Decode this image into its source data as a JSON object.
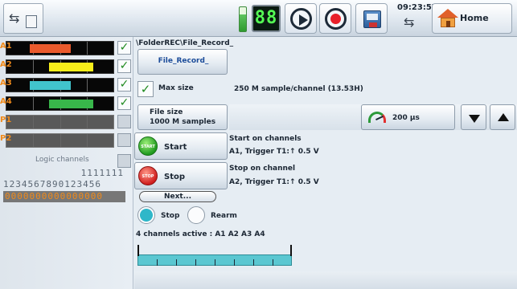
{
  "toolbar": {
    "counter": "88",
    "clock_time": "09:23:57",
    "home_label": "Home",
    "icons": [
      "usb-storage-icon",
      "battery-icon",
      "play-icon",
      "record-icon",
      "disk-icon",
      "usb-icon",
      "home-icon"
    ]
  },
  "channels": [
    {
      "label": "A1",
      "checked": true,
      "fill_color": "#ea5a2c",
      "fill_start": 0.22,
      "fill_end": 0.6
    },
    {
      "label": "A2",
      "checked": true,
      "fill_color": "#f7ee1a",
      "fill_start": 0.4,
      "fill_end": 0.81
    },
    {
      "label": "A3",
      "checked": true,
      "fill_color": "#41c4cc",
      "fill_start": 0.22,
      "fill_end": 0.6
    },
    {
      "label": "A4",
      "checked": true,
      "fill_color": "#38b64a",
      "fill_start": 0.4,
      "fill_end": 0.81
    },
    {
      "label": "P1",
      "checked": false,
      "fill_color": "",
      "fill_start": 0,
      "fill_end": 0
    },
    {
      "label": "P2",
      "checked": false,
      "fill_color": "",
      "fill_start": 0,
      "fill_end": 0
    }
  ],
  "logic": {
    "title": "Logic channels",
    "row1": "1111111",
    "row2": "1234567890123456",
    "row3": "0000000000000000"
  },
  "main": {
    "path": "\\FolderREC\\File_Record_",
    "file_record_button": "File_Record_",
    "max_size_label": "Max size",
    "sample_info": "250 M sample/channel (13.53H)",
    "file_size_line1": "File size",
    "file_size_line2": "1000 M samples",
    "speed_label": "200 µs",
    "start_label": "Start",
    "start_icon_text": "START",
    "start_title": "Start on channels",
    "start_value": "A1, Trigger T1:↑ 0.5 V",
    "stop_label": "Stop",
    "stop_icon_text": "STOP",
    "stop_title": "Stop on channel",
    "stop_value": "A2, Trigger T1:↑ 0.5 V",
    "next_label": "Next...",
    "radio_stop_label": "Stop",
    "radio_rearm_label": "Rearm",
    "active_channels": "4 channels active : A1 A2 A3 A4"
  },
  "colors": {
    "accent_cyan": "#41c4cc",
    "channel_label": "#f08a1a"
  }
}
